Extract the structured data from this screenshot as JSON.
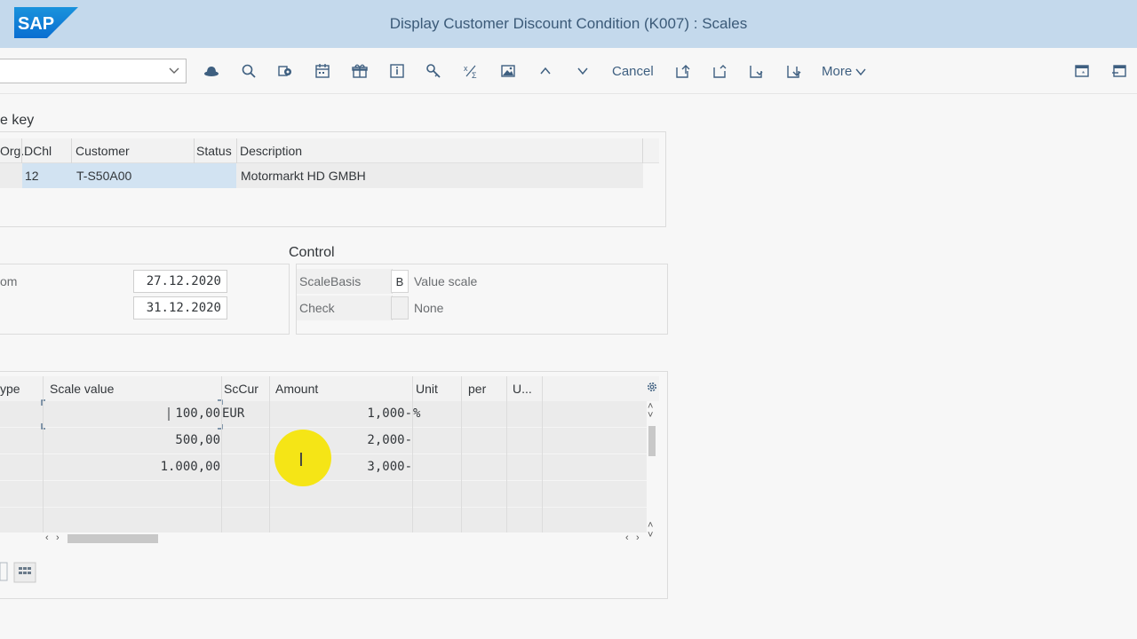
{
  "app": {
    "logo_text": "SAP",
    "window_title": "Display Customer Discount Condition (K007) : Scales",
    "brand_color": "#0a6ed1"
  },
  "toolbar": {
    "command_field_value": "",
    "icons": [
      "hat-icon",
      "find-icon",
      "settings-transfer-icon",
      "calendar-icon",
      "gift-icon",
      "info-icon",
      "search-key-icon",
      "fraction-icon",
      "image-icon",
      "up-icon",
      "down-icon"
    ],
    "cancel_label": "Cancel",
    "more_label": "More",
    "right_icons": [
      "window-star-icon",
      "exit-icon"
    ]
  },
  "key_section": {
    "title": "e key",
    "columns": [
      "Org.",
      "DChl",
      "Customer",
      "Status",
      "Description"
    ],
    "rows": [
      {
        "org": "",
        "dchl": "12",
        "customer": "T-S50A00",
        "status": "",
        "description": "Motormarkt HD GMBH"
      }
    ]
  },
  "validity": {
    "from_label": "om",
    "from_value": "27.12.2020",
    "to_value": "31.12.2020"
  },
  "control": {
    "title": "Control",
    "scale_basis_label": "ScaleBasis",
    "scale_basis_code": "B",
    "scale_basis_text": "Value scale",
    "check_label": "Check",
    "check_code": "",
    "check_text": "None"
  },
  "scales": {
    "columns": [
      "ype",
      "Scale value",
      "ScCur",
      "Amount",
      "Unit",
      "per",
      "U..."
    ],
    "rows": [
      {
        "scale_value": "100,00",
        "sccur": "EUR",
        "amount": "1,000-",
        "unit": "%"
      },
      {
        "scale_value": "500,00",
        "sccur": "",
        "amount": "2,000-",
        "unit": ""
      },
      {
        "scale_value": "1.000,00",
        "sccur": "",
        "amount": "3,000-",
        "unit": ""
      }
    ]
  }
}
